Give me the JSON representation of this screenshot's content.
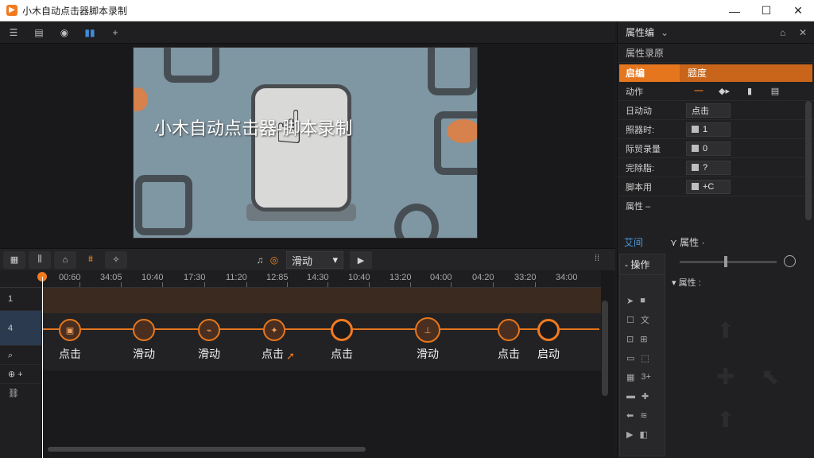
{
  "window": {
    "title": "小木自动点击器脚本录制",
    "logo": "▶",
    "minimize": "—",
    "maximize": "☐",
    "close": "✕"
  },
  "toolbar": {
    "menu_icon": "☰",
    "save_icon": "▤",
    "record_icon": "◉",
    "wave_icon": "▮▮",
    "add_icon": "+"
  },
  "preview": {
    "overlay_text": "小木自动点击器-脚本录制"
  },
  "timeline": {
    "mode_label": "滑动",
    "mode_arrow": "▾",
    "play": "▶",
    "grip": "⁞⁞",
    "ticks": [
      "00:60",
      "34:05",
      "10:40",
      "17:30",
      "11:20",
      "12:85",
      "14:30",
      "10:40",
      "13:20",
      "04:00",
      "04:20",
      "33:20",
      "34:00"
    ],
    "track_labels": [
      "1",
      "4",
      "⌕",
      "⊕ +",
      "⛓"
    ],
    "nodes": [
      {
        "label": "点击",
        "glyph": "▣"
      },
      {
        "label": "滑动",
        "glyph": ""
      },
      {
        "label": "滑动",
        "glyph": "⌁"
      },
      {
        "label": "点击",
        "glyph": "✦"
      },
      {
        "label": "点击",
        "glyph": ""
      },
      {
        "label": "滑动",
        "glyph": "⊥"
      },
      {
        "label": "点击",
        "glyph": ""
      },
      {
        "label": "启动",
        "glyph": ""
      }
    ]
  },
  "right_panel": {
    "header": "属性编",
    "header_arrow": "⌄",
    "pin": "⌂",
    "close": "✕",
    "tab": "属性录原",
    "selected_row": {
      "a": "启编",
      "b": "题度"
    },
    "rows": [
      {
        "label": "动作",
        "value": "segments"
      },
      {
        "label": "日动动",
        "value": "点击"
      },
      {
        "label": "照器时:",
        "value": "1"
      },
      {
        "label": "际贸录量",
        "value": "0"
      },
      {
        "label": "完除脂:",
        "value": "?"
      },
      {
        "label": "脚本用",
        "value": "+C"
      }
    ],
    "segments": [
      "—",
      "◆▸",
      "▮",
      "▤"
    ],
    "attr_label": "属性 –",
    "lower_tabs": {
      "a": "艾间",
      "b": "⋎ 属性 ·"
    },
    "op_head": "- 操作",
    "attr_sub": "▾ 属性 :",
    "op_icons": [
      {
        "a": "➤",
        "b": "■"
      },
      {
        "a": "☐",
        "b": "文"
      },
      {
        "a": "⊡",
        "b": "⊞"
      },
      {
        "a": "▭",
        "b": "⬚"
      },
      {
        "a": "▦",
        "b": "3+"
      },
      {
        "a": "▬",
        "b": "✚"
      },
      {
        "a": "⬅",
        "b": "≋"
      },
      {
        "a": "▶",
        "b": "◧"
      }
    ]
  }
}
